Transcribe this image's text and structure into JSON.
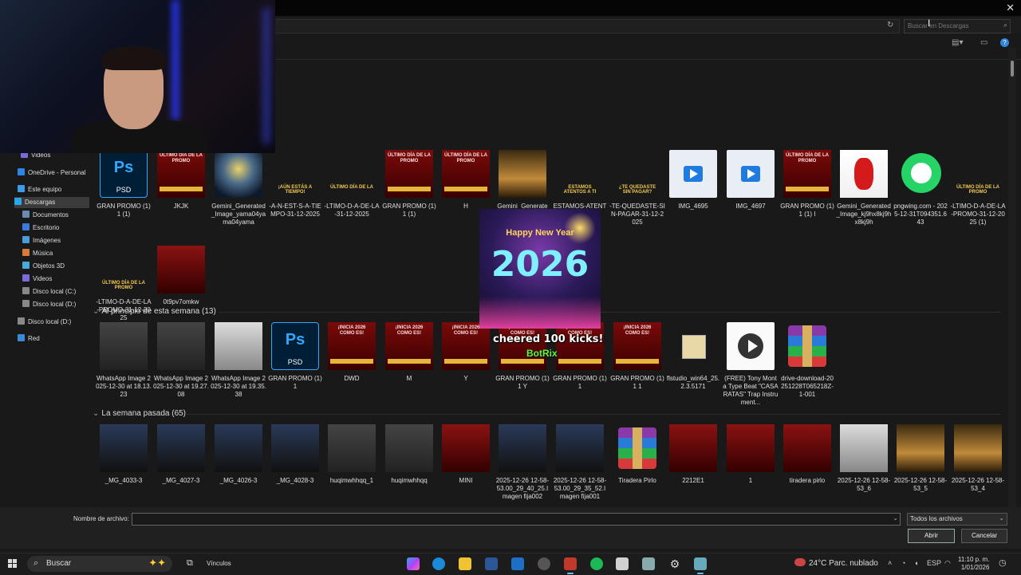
{
  "window": {
    "close_glyph": "✕"
  },
  "search_box": {
    "placeholder": "Buscar en Descargas"
  },
  "sidebar": {
    "items": [
      {
        "label": "Videos",
        "icon": "video-folder-icon",
        "color": "#7b6bd9"
      },
      {
        "label": "OneDrive - Personal",
        "icon": "cloud-icon",
        "color": "#2a86e0"
      },
      {
        "label": "Este equipo",
        "icon": "computer-icon",
        "color": "#3a9be8"
      },
      {
        "label": "Descargas",
        "icon": "download-icon",
        "color": "#2aa6e8",
        "selected": true
      },
      {
        "label": "Documentos",
        "icon": "documents-icon",
        "color": "#6a8ab0"
      },
      {
        "label": "Escritorio",
        "icon": "desktop-icon",
        "color": "#3a7ad8"
      },
      {
        "label": "Imágenes",
        "icon": "pictures-icon",
        "color": "#4a9ad8"
      },
      {
        "label": "Música",
        "icon": "music-icon",
        "color": "#d87a3a"
      },
      {
        "label": "Objetos 3D",
        "icon": "objects-3d-icon",
        "color": "#4aa8d8"
      },
      {
        "label": "Videos",
        "icon": "videos-icon",
        "color": "#7b6bd9"
      },
      {
        "label": "Disco local (C:)",
        "icon": "drive-icon",
        "color": "#888888"
      },
      {
        "label": "Disco local (D:)",
        "icon": "drive-icon",
        "color": "#888888"
      },
      {
        "label": "Disco local (D:)",
        "icon": "drive-icon",
        "color": "#888888"
      },
      {
        "label": "Red",
        "icon": "network-icon",
        "color": "#3a8ad8"
      }
    ]
  },
  "groups": {
    "week_start": "Al principio de esta semana (13)",
    "last_week": "La semana pasada (65)"
  },
  "row1": [
    {
      "label": "GRAN PROMO (1) 1 (1)",
      "kind": "psd"
    },
    {
      "label": "JKJK",
      "kind": "promo",
      "text": "ÚLTIMO DÍA DE LA PROMO"
    },
    {
      "label": "Gemini_Generated_Image_yama04yama04yama",
      "kind": "fest"
    },
    {
      "label": "-A-N-EST-S-A-TIEMPO-31-12-2025",
      "kind": "txt",
      "text": "¡AÚN ESTÁS A TIEMPO!"
    },
    {
      "label": "-LTIMO-D-A-DE-LA-31-12-2025",
      "kind": "txt",
      "text": "ÚLTIMO DÍA DE LA"
    },
    {
      "label": "GRAN PROMO (1) 1 (1)",
      "kind": "promo",
      "text": "ÚLTIMO DÍA DE LA PROMO"
    },
    {
      "label": "H",
      "kind": "promo",
      "text": "ÚLTIMO DÍA DE LA PROMO"
    },
    {
      "label": "Gemini_Generate",
      "kind": "gold"
    },
    {
      "label": "ESTAMOS-ATENT",
      "kind": "txt",
      "text": "ESTAMOS ATENTOS A TI"
    },
    {
      "label": "-TE-QUEDASTE-SIN-PAGAR-31-12-2025",
      "kind": "txt",
      "text": "¿TE QUEDASTE SIN PAGAR?"
    },
    {
      "label": "IMG_4695",
      "kind": "vid"
    },
    {
      "label": "IMG_4697",
      "kind": "vid"
    },
    {
      "label": "GRAN PROMO (1) 1 (1) I",
      "kind": "promo",
      "text": "ÚLTIMO DÍA DE LA PROMO"
    },
    {
      "label": "Gemini_Generated_Image_kj9hx8kj9hx8kj9h",
      "kind": "santa"
    },
    {
      "label": "pngwing.com - 2025-12-31T094351.643",
      "kind": "wa"
    },
    {
      "label": "-LTIMO-D-A-DE-LA-PROMO-31-12-2025 (1)",
      "kind": "txt",
      "text": "ÚLTIMO DÍA DE LA PROMO"
    }
  ],
  "row2": [
    {
      "label": "-LTIMO-D-A-DE-LA-PROMO-31-12-2025",
      "kind": "txt",
      "text": "ÚLTIMO DÍA DE LA PROMO"
    },
    {
      "label": "0t9pv7omkw",
      "kind": "red"
    }
  ],
  "row3": [
    {
      "label": "WhatsApp Image 2025-12-30 at 18.13.23",
      "kind": "photo"
    },
    {
      "label": "WhatsApp Image 2025-12-30 at 19.27.08",
      "kind": "photo"
    },
    {
      "label": "WhatsApp Image 2025-12-30 at 19.35.38",
      "kind": "light"
    },
    {
      "label": "GRAN PROMO (1) 1",
      "kind": "psd"
    },
    {
      "label": "DWD",
      "kind": "promo",
      "text": "¡INICIA 2026 COMO ES!"
    },
    {
      "label": "M",
      "kind": "promo",
      "text": "¡INICIA 2026 COMO ES!"
    },
    {
      "label": "Y",
      "kind": "promo",
      "text": "¡INICIA 2026 COMO ES!"
    },
    {
      "label": "GRAN PROMO (1) 1 Y",
      "kind": "promo",
      "text": "¡INICIA 2026 COMO ES!"
    },
    {
      "label": "GRAN PROMO (1) 1",
      "kind": "promo",
      "text": "¡INICIA 2026 COMO ES!"
    },
    {
      "label": "GRAN PROMO (1) 1 1",
      "kind": "promo",
      "text": "¡INICIA 2026 COMO ES!"
    },
    {
      "label": "flstudio_win64_25.2.3.5171",
      "kind": "inst"
    },
    {
      "label": "(FREE) Tony Monta Type Beat \"CASA RATAS\" Trap Instrument...",
      "kind": "play"
    },
    {
      "label": "drive-download-20251228T065218Z-1-001",
      "kind": "rar"
    }
  ],
  "row4": [
    {
      "label": "_MG_4033-3",
      "kind": "blue"
    },
    {
      "label": "_MG_4027-3",
      "kind": "blue"
    },
    {
      "label": "_MG_4026-3",
      "kind": "blue"
    },
    {
      "label": "_MG_4028-3",
      "kind": "blue"
    },
    {
      "label": "huqimwhhqq_1",
      "kind": "photo"
    },
    {
      "label": "huqimwhhqq",
      "kind": "photo"
    },
    {
      "label": "MINI",
      "kind": "red"
    },
    {
      "label": "2025-12-26 12-58-53.00_29_40_25.Imagen fija002",
      "kind": "blue"
    },
    {
      "label": "2025-12-26 12-58-53.00_29_35_52.Imagen fija001",
      "kind": "blue"
    },
    {
      "label": "Tiradera Pirlo",
      "kind": "rar"
    },
    {
      "label": "2212E1",
      "kind": "red"
    },
    {
      "label": "1",
      "kind": "red"
    },
    {
      "label": "tiradera pirlo",
      "kind": "red"
    },
    {
      "label": "2025-12-26 12-58-53_6",
      "kind": "light"
    },
    {
      "label": "2025-12-26 12-58-53_5",
      "kind": "gold"
    },
    {
      "label": "2025-12-26 12-58-53_4",
      "kind": "gold"
    }
  ],
  "overlay": {
    "greeting": "Happy New Year",
    "year": "2026",
    "alert": "cheered 100 kicks!",
    "brand": "BotRix"
  },
  "footer": {
    "filename_label": "Nombre de archivo:",
    "filename_value": "",
    "filetype": "Todos los archivos",
    "open_label": "Abrir",
    "cancel_label": "Cancelar"
  },
  "taskbar": {
    "search_label": "Buscar",
    "link_label": "Vínculos",
    "weather": "24°C  Parc. nublado",
    "lang": "ESP",
    "time": "11:10 p. m.",
    "date": "1/01/2026"
  }
}
